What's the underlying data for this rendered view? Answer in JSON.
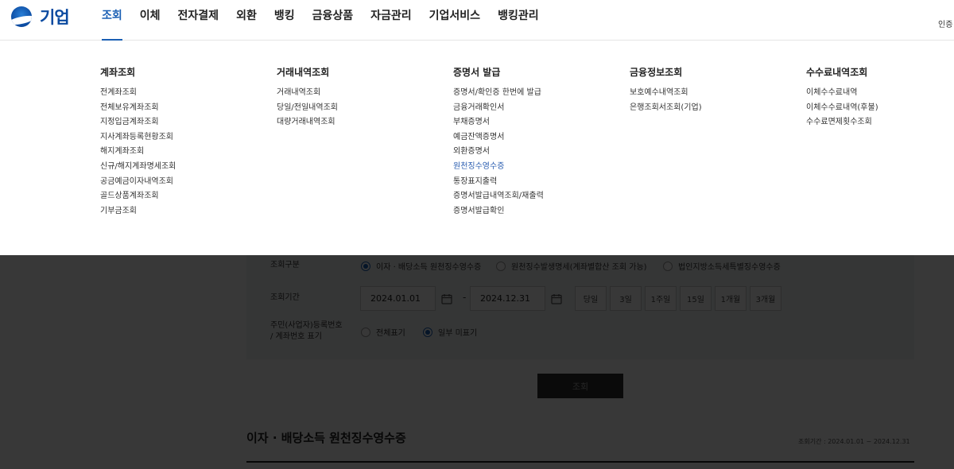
{
  "header": {
    "logo_text": "기업",
    "menu": [
      "조회",
      "이체",
      "전자결제",
      "외환",
      "뱅킹",
      "금융상품",
      "자금관리",
      "기업서비스",
      "뱅킹관리"
    ],
    "active_menu": "조회",
    "auth_label": "인증"
  },
  "mega_menu": [
    {
      "title": "계좌조회",
      "links": [
        "전계좌조회",
        "전체보유계좌조회",
        "지정입금계좌조회",
        "지사계좌등록현황조회",
        "해지계좌조회",
        "신규/해지계좌명세조회",
        "공금예금이자내역조회",
        "골드상품계좌조회",
        "기부금조회"
      ]
    },
    {
      "title": "거래내역조회",
      "links": [
        "거래내역조회",
        "당일/전일내역조회",
        "대량거래내역조회"
      ]
    },
    {
      "title": "증명서 발급",
      "links": [
        "증명서/확인증 한번에 발급",
        "금융거래확인서",
        "부채증명서",
        "예금잔액증명서",
        "외환증명서",
        "원천징수영수증",
        "통장표지출력",
        "증명서발급내역조회/재출력",
        "증명서발급확인"
      ],
      "highlighted": "원천징수영수증"
    },
    {
      "title": "금융정보조회",
      "links": [
        "보호예수내역조회",
        "은행조회서조회(기업)"
      ]
    },
    {
      "title": "수수료내역조회",
      "links": [
        "이체수수료내역",
        "이체수수료내역(후불)",
        "수수료면제횟수조회"
      ]
    }
  ],
  "form": {
    "type_label": "조회구분",
    "type_options": [
      "이자 · 배당소득 원천징수영수증",
      "원천징수발생명세(계좌별합산 조회 가능)",
      "법인지방소득세특별징수영수증"
    ],
    "type_selected": "이자 · 배당소득 원천징수영수증",
    "period_label": "조회기간",
    "start_date": "2024.01.01",
    "end_date": "2024.12.31",
    "date_separator": "-",
    "period_buttons": [
      "당일",
      "3일",
      "1주일",
      "15일",
      "1개월",
      "3개월"
    ],
    "id_label_line1": "주민(사업자)등록번호",
    "id_label_line2": "/ 계좌번호 표기",
    "id_options": [
      "전체표기",
      "일부 미표기"
    ],
    "id_selected": "일부 미표기",
    "search_button": "조회"
  },
  "result": {
    "title": "이자 · 배당소득 원천징수영수증",
    "period_text": "조회기간 : 2024.01.01 ~ 2024.12.31"
  },
  "colors": {
    "brand": "#0b4aa0",
    "active": "#1a5fb4",
    "highlight_link": "#2a5db0"
  },
  "icons": {
    "calendar": "calendar-icon"
  }
}
